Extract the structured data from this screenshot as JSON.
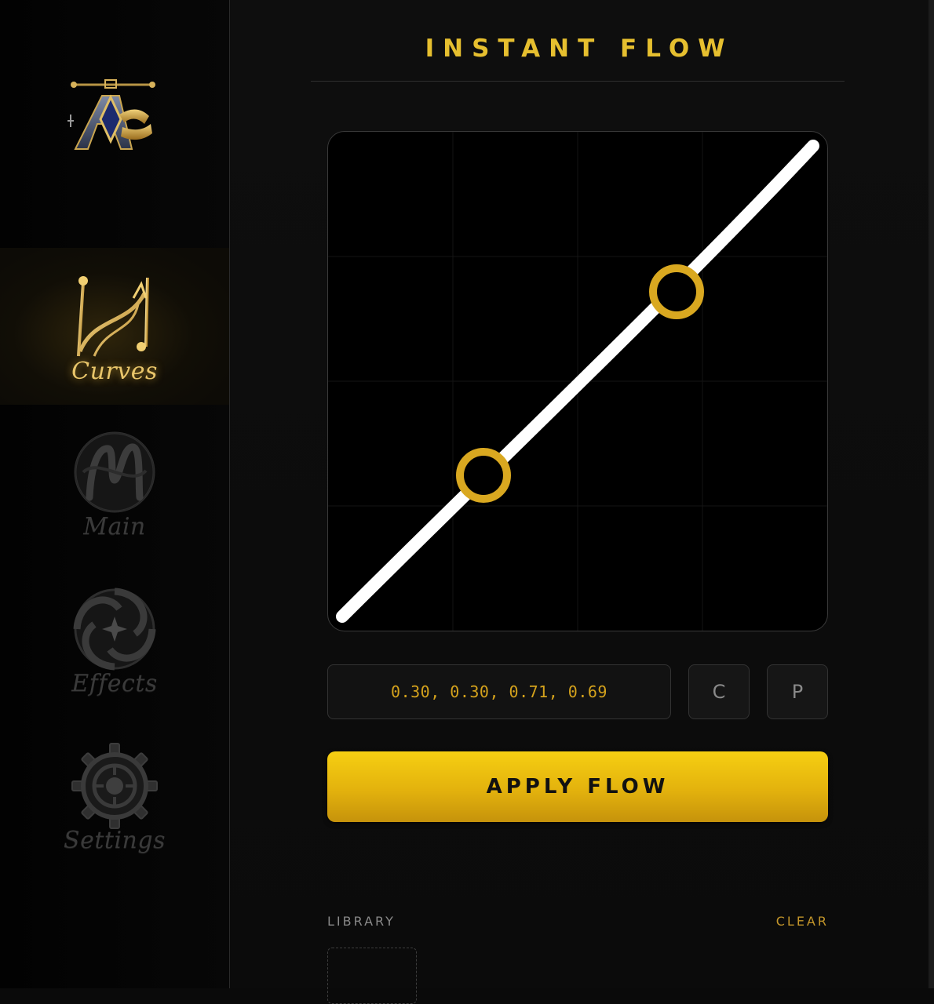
{
  "sidebar": {
    "items": [
      {
        "label": "Curves",
        "icon": "curves-icon",
        "active": true
      },
      {
        "label": "Main",
        "icon": "main-monogram-icon",
        "active": false
      },
      {
        "label": "Effects",
        "icon": "effects-swirl-icon",
        "active": false
      },
      {
        "label": "Settings",
        "icon": "gear-icon",
        "active": false
      }
    ]
  },
  "header": {
    "title": "INSTANT FLOW"
  },
  "curve": {
    "p1": [
      0.3,
      0.3
    ],
    "p2": [
      0.71,
      0.69
    ],
    "value_text": "0.30, 0.30, 0.71, 0.69"
  },
  "controls": {
    "copy_label": "C",
    "paste_label": "P",
    "apply_label": "APPLY FLOW"
  },
  "library": {
    "label": "LIBRARY",
    "clear_label": "CLEAR"
  },
  "colors": {
    "accent": "#e6bf2f",
    "handle": "#d9a820",
    "curve": "#ffffff",
    "background": "#0a0a0a"
  }
}
